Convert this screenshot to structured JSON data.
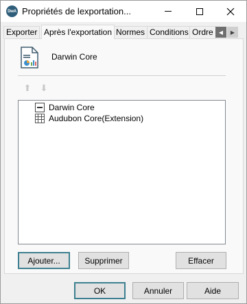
{
  "window": {
    "title": "Propriétés de lexportation...",
    "app_icon_text": "DwA"
  },
  "tabs": [
    {
      "label": "Exporter",
      "active": false
    },
    {
      "label": "Après l'exportation",
      "active": true
    },
    {
      "label": "Normes",
      "active": false
    },
    {
      "label": "Conditions",
      "active": false
    },
    {
      "label": "Ordre",
      "active": false
    }
  ],
  "panel": {
    "header_label": "Darwin Core",
    "list_items": [
      {
        "label": "Darwin Core",
        "icon": "core-icon"
      },
      {
        "label": "Audubon Core(Extension)",
        "icon": "grid-table-icon"
      }
    ],
    "buttons": {
      "add": "Ajouter...",
      "remove": "Supprimer",
      "clear": "Effacer"
    }
  },
  "footer": {
    "ok": "OK",
    "cancel": "Annuler",
    "help": "Aide"
  }
}
